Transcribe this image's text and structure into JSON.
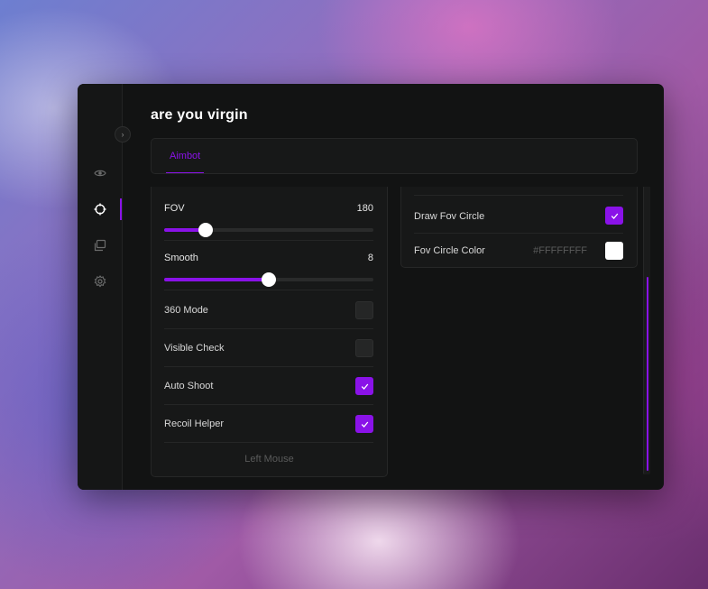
{
  "window": {
    "title": "are you virgin"
  },
  "sidebar": {
    "items": [
      {
        "icon": "eye-icon",
        "active": false
      },
      {
        "icon": "crosshair-icon",
        "active": true
      },
      {
        "icon": "layers-icon",
        "active": false
      },
      {
        "icon": "gear-icon",
        "active": false
      }
    ]
  },
  "tabs": [
    {
      "label": "Aimbot",
      "active": true
    }
  ],
  "left_panel": {
    "fov": {
      "label": "FOV",
      "value": "180",
      "fraction": 0.2
    },
    "smooth": {
      "label": "Smooth",
      "value": "8",
      "fraction": 0.5
    },
    "mode360": {
      "label": "360 Mode",
      "checked": false
    },
    "visible_check": {
      "label": "Visible Check",
      "checked": false
    },
    "auto_shoot": {
      "label": "Auto Shoot",
      "checked": true
    },
    "recoil_helper": {
      "label": "Recoil Helper",
      "checked": true
    },
    "keybind": "Left Mouse"
  },
  "right_panel": {
    "draw_fov_circle": {
      "label": "Draw Fov Circle",
      "checked": true
    },
    "fov_circle_color": {
      "label": "Fov Circle Color",
      "hex": "#FFFFFFFF",
      "color": "#ffffff"
    }
  },
  "colors": {
    "accent": "#8a12e8",
    "background": "#121313",
    "panel": "#171818"
  }
}
